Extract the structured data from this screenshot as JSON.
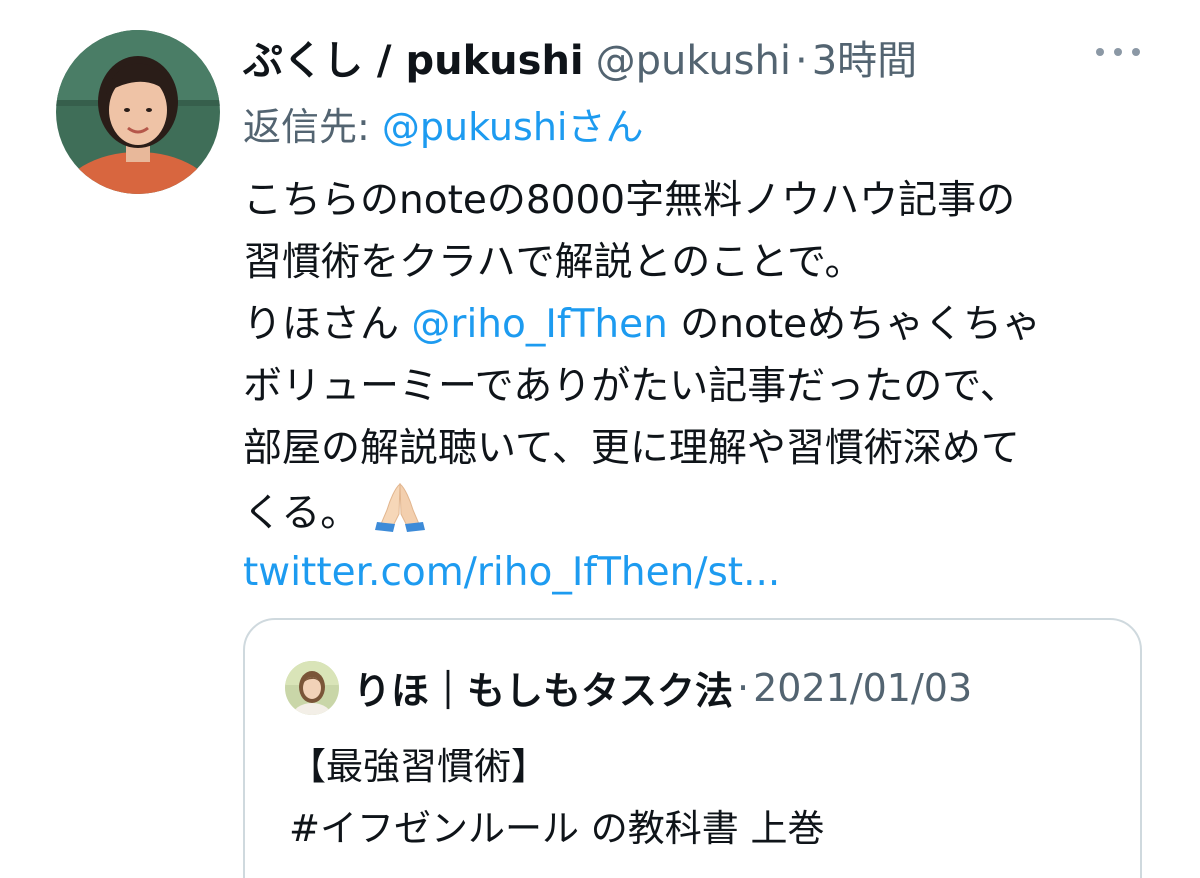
{
  "tweet": {
    "author": {
      "display_name": "ぷくし / pukushi",
      "handle": "@pukushi",
      "separator": "·",
      "time": "3時間"
    },
    "reply": {
      "prefix": "返信先: ",
      "handle": "@pukushi",
      "suffix": "さん"
    },
    "body": {
      "line1": "こちらのnoteの8000字無料ノウハウ記事の",
      "line2": "習慣術をクラハで解説とのことで。",
      "line3_pre": "りほさん ",
      "line3_mention": "@riho_IfThen",
      "line3_post": " のnoteめちゃくちゃ",
      "line4": "ボリューミーでありがたい記事だったので、",
      "line5": "部屋の解説聴いて、更に理解や習慣術深めて",
      "line6": "くる。",
      "link": "twitter.com/riho_IfThen/st..."
    },
    "emoji": "folded-hands-icon",
    "quote": {
      "name": "りほ｜もしもタスク法",
      "separator": "·",
      "date": "2021/01/03",
      "line1": "【最強習慣術】",
      "line2": "#イフゼンルール の教科書 上巻"
    }
  },
  "colors": {
    "accent": "#1d9bf0",
    "text_primary": "#0f1419",
    "text_secondary": "#536471",
    "border": "#cfd9de"
  }
}
